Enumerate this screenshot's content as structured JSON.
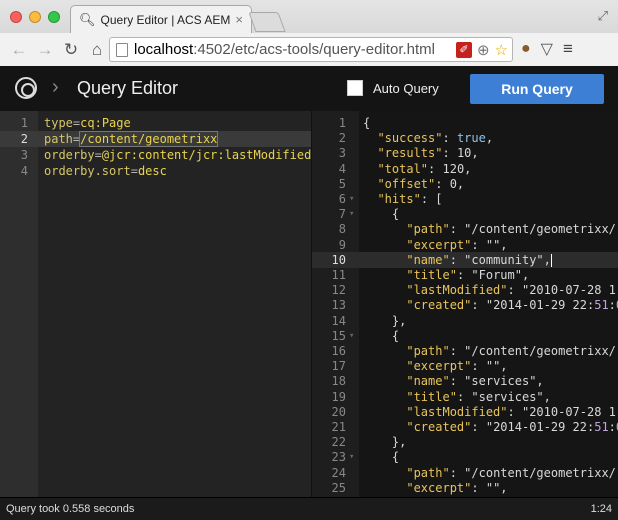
{
  "browser": {
    "tab_title": "Query Editor | ACS AEM To",
    "tab_close": "×",
    "url_host": "localhost",
    "url_rest": ":4502/etc/acs-tools/query-editor.html",
    "traffic_colors": [
      "#fc605c",
      "#fdbc40",
      "#34c84a"
    ],
    "icons": {
      "back": "back-arrow-icon",
      "forward": "forward-arrow-icon",
      "reload": "reload-icon",
      "home": "home-icon",
      "pdf": "pdf-icon",
      "zoom": "zoom-icon",
      "star": "star-icon",
      "menu": "menu-icon"
    }
  },
  "header": {
    "title": "Query Editor",
    "auto_query_label": "Auto Query",
    "run_button": "Run Query",
    "accent": "#3d7fd5"
  },
  "query_editor": {
    "active_line": 2,
    "lines": [
      {
        "n": "1",
        "key": "type",
        "val": "cq:Page"
      },
      {
        "n": "2",
        "key": "path",
        "val": "/content/geometrixx"
      },
      {
        "n": "3",
        "key": "orderby",
        "val": "@jcr:content/jcr:lastModified"
      },
      {
        "n": "4",
        "key": "orderby.sort",
        "val": "desc"
      }
    ]
  },
  "result_editor": {
    "active_line": 10,
    "lines": [
      {
        "n": "1",
        "fold": false,
        "text": "{"
      },
      {
        "n": "2",
        "fold": false,
        "text": "  \"success\": true,"
      },
      {
        "n": "3",
        "fold": false,
        "text": "  \"results\": 10,"
      },
      {
        "n": "4",
        "fold": false,
        "text": "  \"total\": 120,"
      },
      {
        "n": "5",
        "fold": false,
        "text": "  \"offset\": 0,"
      },
      {
        "n": "6",
        "fold": true,
        "text": "  \"hits\": ["
      },
      {
        "n": "7",
        "fold": true,
        "text": "    {"
      },
      {
        "n": "8",
        "fold": false,
        "text": "      \"path\": \"/content/geometrixx/"
      },
      {
        "n": "9",
        "fold": false,
        "text": "      \"excerpt\": \"\","
      },
      {
        "n": "10",
        "fold": false,
        "text": "      \"name\": \"community\","
      },
      {
        "n": "11",
        "fold": false,
        "text": "      \"title\": \"Forum\","
      },
      {
        "n": "12",
        "fold": false,
        "text": "      \"lastModified\": \"2010-07-28 1"
      },
      {
        "n": "13",
        "fold": false,
        "text": "      \"created\": \"2014-01-29 22:51:0"
      },
      {
        "n": "14",
        "fold": false,
        "text": "    },"
      },
      {
        "n": "15",
        "fold": true,
        "text": "    {"
      },
      {
        "n": "16",
        "fold": false,
        "text": "      \"path\": \"/content/geometrixx/"
      },
      {
        "n": "17",
        "fold": false,
        "text": "      \"excerpt\": \"\","
      },
      {
        "n": "18",
        "fold": false,
        "text": "      \"name\": \"services\","
      },
      {
        "n": "19",
        "fold": false,
        "text": "      \"title\": \"services\","
      },
      {
        "n": "20",
        "fold": false,
        "text": "      \"lastModified\": \"2010-07-28 1"
      },
      {
        "n": "21",
        "fold": false,
        "text": "      \"created\": \"2014-01-29 22:51:0"
      },
      {
        "n": "22",
        "fold": false,
        "text": "    },"
      },
      {
        "n": "23",
        "fold": true,
        "text": "    {"
      },
      {
        "n": "24",
        "fold": false,
        "text": "      \"path\": \"/content/geometrixx/"
      },
      {
        "n": "25",
        "fold": false,
        "text": "      \"excerpt\": \"\","
      }
    ]
  },
  "status": {
    "message": "Query took 0.558 seconds",
    "position": "1:24"
  }
}
